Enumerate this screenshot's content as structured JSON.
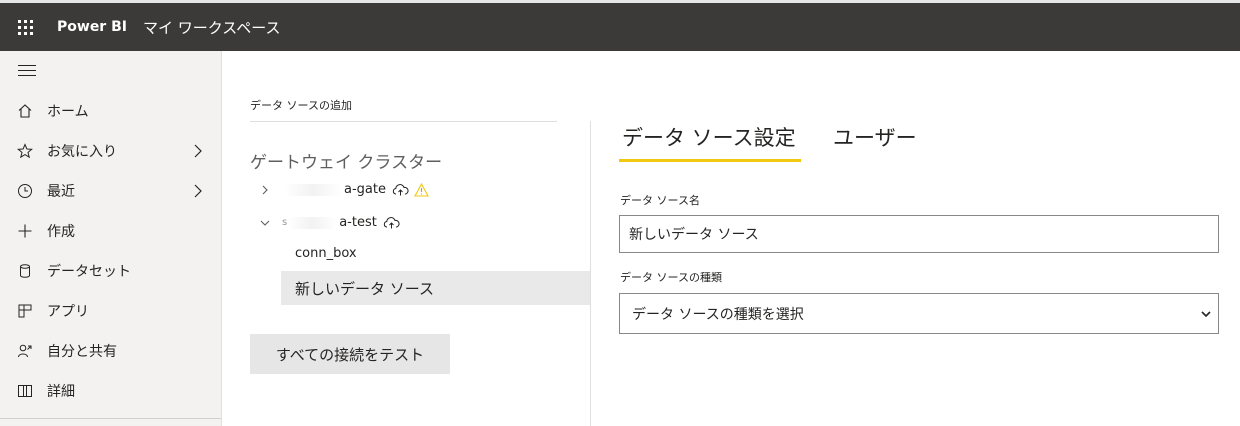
{
  "topbar": {
    "app_name": "Power BI",
    "workspace": "マイ ワークスペース"
  },
  "sidebar": {
    "items": [
      {
        "label": "ホーム",
        "icon": "home-icon",
        "has_chevron": false
      },
      {
        "label": "お気に入り",
        "icon": "star-icon",
        "has_chevron": true
      },
      {
        "label": "最近",
        "icon": "clock-icon",
        "has_chevron": true
      },
      {
        "label": "作成",
        "icon": "plus-icon",
        "has_chevron": false
      },
      {
        "label": "データセット",
        "icon": "database-icon",
        "has_chevron": false
      },
      {
        "label": "アプリ",
        "icon": "apps-icon",
        "has_chevron": false
      },
      {
        "label": "自分と共有",
        "icon": "person-share-icon",
        "has_chevron": false
      },
      {
        "label": "詳細",
        "icon": "book-icon",
        "has_chevron": false
      }
    ]
  },
  "left_panel": {
    "breadcrumb": "データ ソースの追加",
    "cluster_title": "ゲートウェイ クラスター",
    "gateways": [
      {
        "name": "a-gate",
        "expanded": false,
        "warning": true
      },
      {
        "name": "a-test",
        "expanded": true,
        "warning": false,
        "prefix": "s"
      }
    ],
    "connections": [
      "conn_box",
      "新しいデータ ソース"
    ],
    "test_button": "すべての接続をテスト"
  },
  "right_panel": {
    "tabs": [
      "データ ソース設定",
      "ユーザー"
    ],
    "active_tab": 0,
    "name_label": "データ ソース名",
    "name_value": "新しいデータ ソース",
    "type_label": "データ ソースの種類",
    "type_placeholder": "データ ソースの種類を選択"
  },
  "colors": {
    "topbar": "#3b3a39",
    "sidebar": "#f3f2f1",
    "accent": "#f2c811",
    "warning": "#f2c811"
  }
}
